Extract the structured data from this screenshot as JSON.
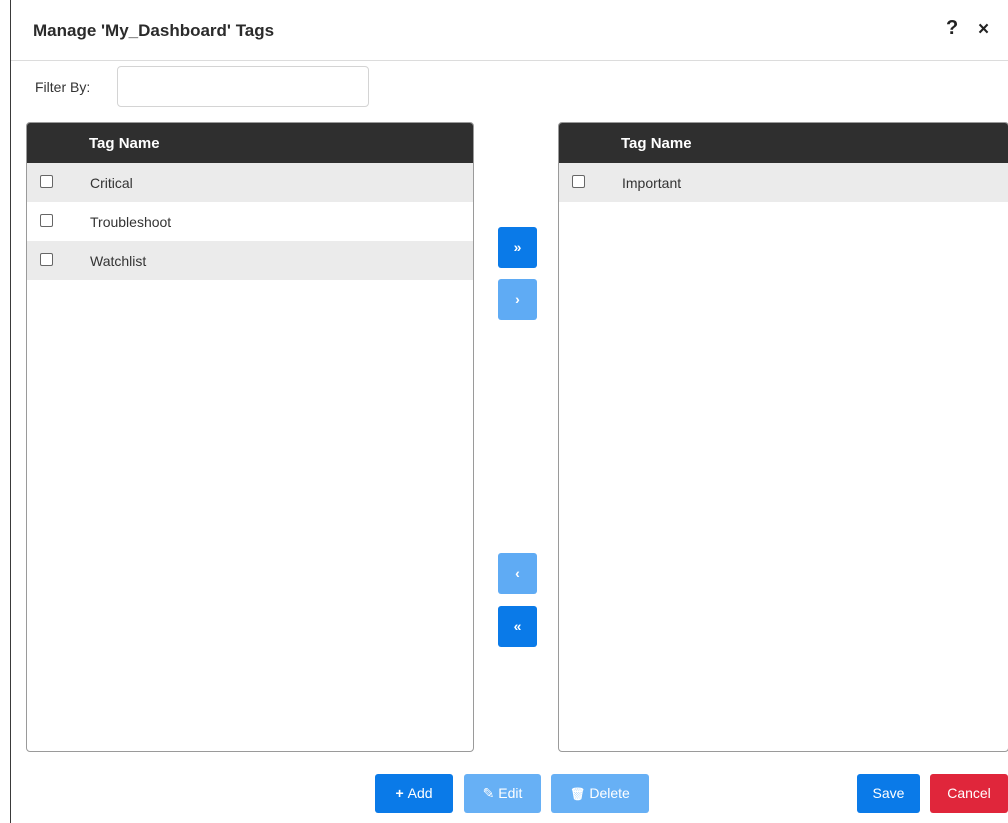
{
  "dialog": {
    "title": "Manage 'My_Dashboard' Tags",
    "help_icon": "?",
    "close_icon": "×"
  },
  "filter": {
    "label": "Filter By:",
    "value": "",
    "placeholder": ""
  },
  "available_list": {
    "header": "Tag Name",
    "items": [
      {
        "label": "Critical",
        "checked": false
      },
      {
        "label": "Troubleshoot",
        "checked": false
      },
      {
        "label": "Watchlist",
        "checked": false
      }
    ]
  },
  "selected_list": {
    "header": "Tag Name",
    "items": [
      {
        "label": "Important",
        "checked": false
      }
    ]
  },
  "move_buttons": {
    "move_all_right": "»",
    "move_right": "›",
    "move_left": "‹",
    "move_all_left": "«"
  },
  "footer": {
    "add_label": "Add",
    "add_icon": "+",
    "edit_label": "Edit",
    "edit_icon": "✎",
    "delete_label": "Delete",
    "delete_icon": "🗑",
    "save_label": "Save",
    "cancel_label": "Cancel"
  },
  "colors": {
    "primary": "#0a7ae8",
    "primary_disabled": "#5fabf4",
    "danger": "#e0263b",
    "header_bg": "#2f2f2f",
    "row_alt": "#ebebeb"
  }
}
